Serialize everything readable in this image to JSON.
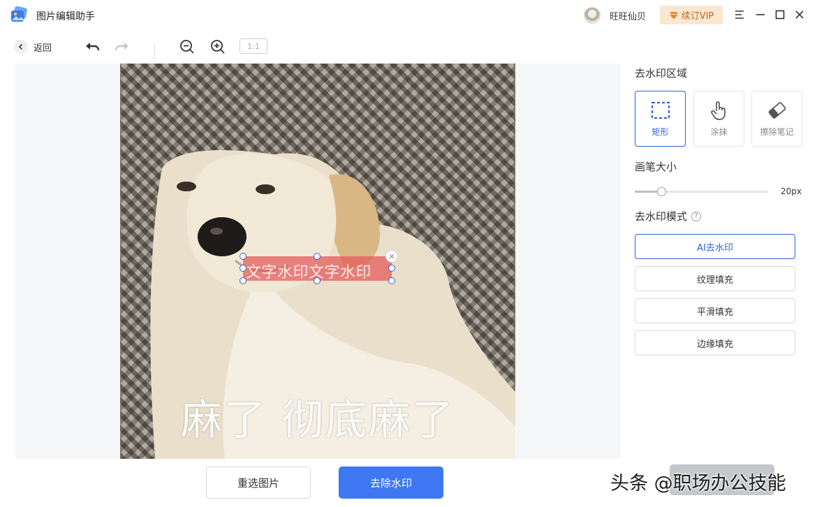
{
  "app": {
    "title": "图片编辑助手"
  },
  "user": {
    "name": "旺旺仙贝",
    "vip_label": "续订VIP"
  },
  "toolbar": {
    "back_label": "返回",
    "ratio_label": "1:1"
  },
  "canvas": {
    "meme_caption": "麻了 彻底麻了",
    "selection_text": "文字水印文字水印"
  },
  "panel": {
    "region_title": "去水印区域",
    "modes": [
      {
        "label": "矩形",
        "icon": "dashed-rectangle-icon",
        "active": true
      },
      {
        "label": "涂抹",
        "icon": "hand-pointer-icon",
        "active": false
      },
      {
        "label": "擦除笔记",
        "icon": "eraser-icon",
        "active": false
      }
    ],
    "brush_title": "画笔大小",
    "brush_value_label": "20px",
    "brush_fraction": 0.2,
    "mode_title": "去水印模式",
    "options": [
      {
        "label": "AI去水印",
        "active": true
      },
      {
        "label": "纹理填充",
        "active": false
      },
      {
        "label": "平滑填充",
        "active": false
      },
      {
        "label": "边缘填充",
        "active": false
      }
    ]
  },
  "actions": {
    "reselect_label": "重选图片",
    "remove_label": "去除水印"
  },
  "overlay_watermark": "头条 @职场办公技能",
  "colors": {
    "accent": "#3d77f2",
    "vip_bg": "#fbe6d0",
    "vip_text": "#b86d22",
    "selection": "#e45858"
  }
}
